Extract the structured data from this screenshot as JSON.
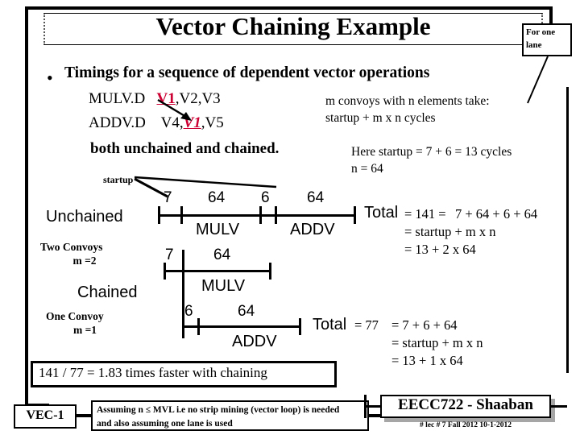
{
  "slide": {
    "title": "Vector Chaining Example",
    "callout": "For one\nlane",
    "callout_line1": "For one",
    "callout_line2": "lane",
    "bullet_marker": "•",
    "bullet": "Timings for a sequence of dependent vector operations"
  },
  "code": {
    "line1_op": "MULV.D",
    "line1_dest": "V1",
    "line1_rest": ",V2,V3",
    "line2_op": "ADDV.D",
    "line2_pre": "V4,",
    "line2_src": "V1",
    "line2_rest": ",V5",
    "line3": "both unchained and chained.",
    "highlight_color": "#cc0033"
  },
  "notes": {
    "convoys": "m convoys with n elements take:",
    "formula": "startup + m x n  cycles",
    "startup_value": "Here startup = 7 + 6 = 13 cycles",
    "n_value": "n = 64"
  },
  "unchained": {
    "caption": "Unchained",
    "startup_label": "startup",
    "seg1_value": "7",
    "seg2_value": "64",
    "seg3_value": "6",
    "seg4_value": "64",
    "op1": "MULV",
    "op2": "ADDV",
    "total_word": "Total",
    "total_eq": "= 141 =",
    "calc1": "7 + 64 + 6 + 64",
    "calc2": "= startup + m x n",
    "calc3": "=  13        + 2 x 64"
  },
  "chained": {
    "caption": "Chained",
    "convoys_two_line1": "Two Convoys",
    "convoys_two_line2": "m =2",
    "convoys_one_line1": "One Convoy",
    "convoys_one_line2": "m =1",
    "mulv_startup": "7",
    "mulv_len": "64",
    "mulv_op": "MULV",
    "addv_startup": "6",
    "addv_len": "64",
    "addv_op": "ADDV",
    "total_word": "Total",
    "total_eq": "= 77",
    "calc1": "=  7 + 6 + 64",
    "calc2": "=  startup + m x n",
    "calc3": "=  13       +  1 x 64"
  },
  "speedup": {
    "text": "141 / 77 = 1.83 times faster with chaining"
  },
  "footer": {
    "vec_label": "VEC-1",
    "assumption_line1": "Assuming n ≤ MVL  i.e no strip mining (vector loop) is needed",
    "assumption_line2": "and also assuming one lane is used",
    "course": "EECC722 - Shaaban",
    "meta": "#  lec # 7    Fall 2012   10-1-2012"
  }
}
